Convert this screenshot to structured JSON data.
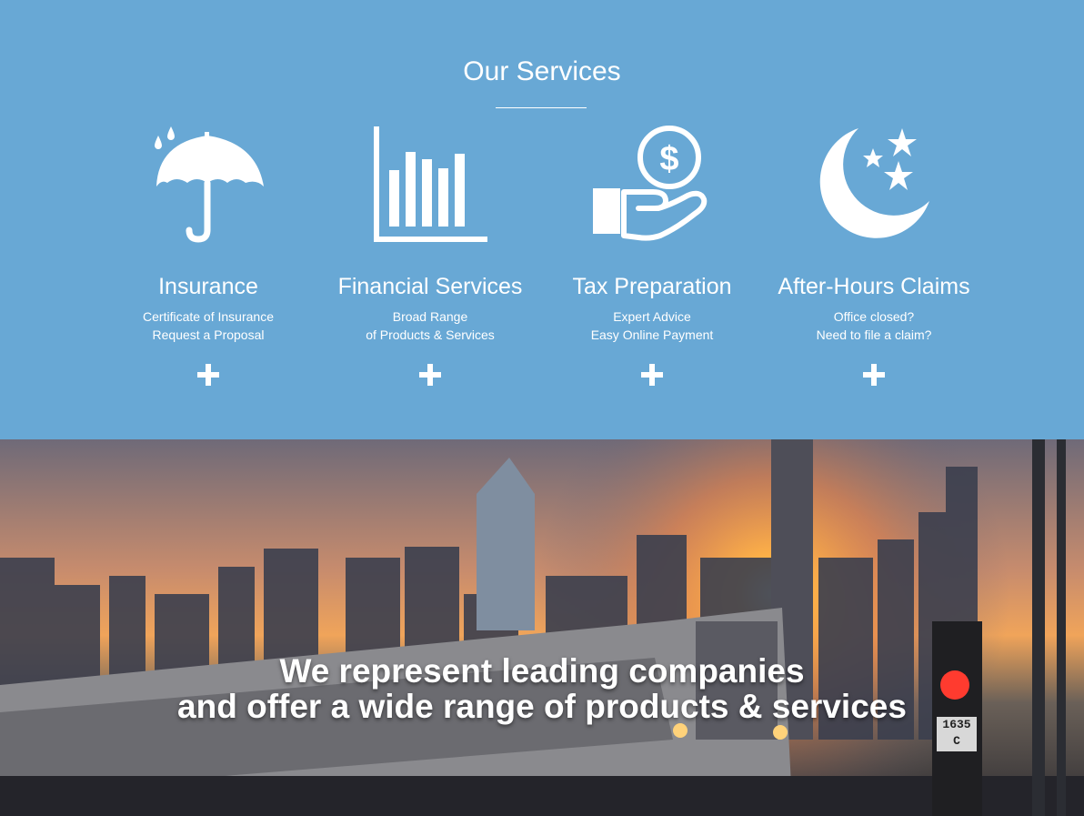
{
  "header": {
    "menu_icon": "hamburger-icon"
  },
  "services": {
    "title": "Our Services",
    "items": [
      {
        "icon": "umbrella-icon",
        "name": "Insurance",
        "line1": "Certificate of Insurance",
        "line2": "Request a Proposal"
      },
      {
        "icon": "bar-chart-icon",
        "name": "Financial Services",
        "line1": "Broad Range",
        "line2": "of Products & Services"
      },
      {
        "icon": "money-hand-icon",
        "name": "Tax Preparation",
        "line1": "Expert Advice",
        "line2": "Easy Online Payment"
      },
      {
        "icon": "moon-stars-icon",
        "name": "After-Hours Claims",
        "line1": "Office closed?",
        "line2": "Need to file a claim?"
      }
    ]
  },
  "hero": {
    "line1": "We represent leading companies",
    "line2": "and offer a wide range of products & services",
    "sign_number": "1635",
    "sign_letter": "C"
  },
  "colors": {
    "services_bg": "#68a8d5",
    "menu_bg": "#41627d"
  }
}
